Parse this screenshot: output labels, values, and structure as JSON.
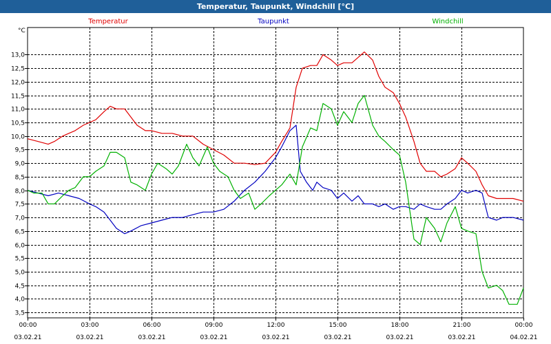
{
  "window": {
    "title": "Temperatur, Taupunkt, Windchill [°C]"
  },
  "chart_data": {
    "type": "line",
    "title": "Temperatur, Taupunkt, Windchill [°C]",
    "ylabel": "°C",
    "ylim": [
      3.3,
      14.0
    ],
    "xlim": [
      0,
      24
    ],
    "grid": true,
    "legend_position": "top",
    "y_ticks": [
      "3,5",
      "4,0",
      "4,5",
      "5,0",
      "5,5",
      "6,0",
      "6,5",
      "7,0",
      "7,5",
      "8,0",
      "8,5",
      "9,0",
      "9,5",
      "10,0",
      "10,5",
      "11,0",
      "11,5",
      "12,0",
      "12,5",
      "13,0"
    ],
    "y_tick_values": [
      3.5,
      4.0,
      4.5,
      5.0,
      5.5,
      6.0,
      6.5,
      7.0,
      7.5,
      8.0,
      8.5,
      9.0,
      9.5,
      10.0,
      10.5,
      11.0,
      11.5,
      12.0,
      12.5,
      13.0
    ],
    "x_ticks": [
      {
        "hours": 0,
        "time": "00:00",
        "date": "03.02.21"
      },
      {
        "hours": 3,
        "time": "03:00",
        "date": "03.02.21"
      },
      {
        "hours": 6,
        "time": "06:00",
        "date": "03.02.21"
      },
      {
        "hours": 9,
        "time": "09:00",
        "date": "03.02.21"
      },
      {
        "hours": 12,
        "time": "12:00",
        "date": "03.02.21"
      },
      {
        "hours": 15,
        "time": "15:00",
        "date": "03.02.21"
      },
      {
        "hours": 18,
        "time": "18:00",
        "date": "03.02.21"
      },
      {
        "hours": 21,
        "time": "21:00",
        "date": "03.02.21"
      },
      {
        "hours": 24,
        "time": "00:00",
        "date": "04.02.21"
      }
    ],
    "series": [
      {
        "name": "Temperatur",
        "color": "#e00000",
        "points": [
          [
            0,
            9.9
          ],
          [
            0.5,
            9.8
          ],
          [
            1,
            9.7
          ],
          [
            1.3,
            9.8
          ],
          [
            1.7,
            10.0
          ],
          [
            2,
            10.1
          ],
          [
            2.3,
            10.2
          ],
          [
            2.7,
            10.4
          ],
          [
            3,
            10.5
          ],
          [
            3.3,
            10.6
          ],
          [
            3.7,
            10.9
          ],
          [
            4,
            11.1
          ],
          [
            4.3,
            11.0
          ],
          [
            4.7,
            11.0
          ],
          [
            5,
            10.7
          ],
          [
            5.3,
            10.4
          ],
          [
            5.7,
            10.2
          ],
          [
            6,
            10.2
          ],
          [
            6.5,
            10.1
          ],
          [
            7,
            10.1
          ],
          [
            7.5,
            10.0
          ],
          [
            8,
            10.0
          ],
          [
            8.5,
            9.7
          ],
          [
            9,
            9.5
          ],
          [
            9.5,
            9.3
          ],
          [
            10,
            9.0
          ],
          [
            10.5,
            9.0
          ],
          [
            11,
            8.95
          ],
          [
            11.5,
            9.0
          ],
          [
            12,
            9.4
          ],
          [
            12.3,
            9.8
          ],
          [
            12.7,
            10.3
          ],
          [
            13,
            11.8
          ],
          [
            13.3,
            12.5
          ],
          [
            13.7,
            12.6
          ],
          [
            14,
            12.6
          ],
          [
            14.3,
            13.0
          ],
          [
            14.7,
            12.8
          ],
          [
            15,
            12.6
          ],
          [
            15.3,
            12.7
          ],
          [
            15.7,
            12.7
          ],
          [
            16,
            12.9
          ],
          [
            16.3,
            13.1
          ],
          [
            16.7,
            12.8
          ],
          [
            17,
            12.2
          ],
          [
            17.3,
            11.8
          ],
          [
            17.7,
            11.6
          ],
          [
            18,
            11.2
          ],
          [
            18.3,
            10.7
          ],
          [
            18.7,
            9.8
          ],
          [
            19,
            9.0
          ],
          [
            19.3,
            8.7
          ],
          [
            19.7,
            8.7
          ],
          [
            20,
            8.5
          ],
          [
            20.3,
            8.6
          ],
          [
            20.7,
            8.8
          ],
          [
            21,
            9.2
          ],
          [
            21.3,
            9.0
          ],
          [
            21.7,
            8.7
          ],
          [
            22,
            8.2
          ],
          [
            22.3,
            7.8
          ],
          [
            22.7,
            7.7
          ],
          [
            23,
            7.7
          ],
          [
            23.5,
            7.7
          ],
          [
            24,
            7.6
          ]
        ]
      },
      {
        "name": "Taupunkt",
        "color": "#0000c0",
        "points": [
          [
            0,
            8.0
          ],
          [
            0.5,
            7.9
          ],
          [
            1,
            7.8
          ],
          [
            1.5,
            7.9
          ],
          [
            2,
            7.8
          ],
          [
            2.5,
            7.7
          ],
          [
            3,
            7.5
          ],
          [
            3.3,
            7.4
          ],
          [
            3.7,
            7.2
          ],
          [
            4,
            6.9
          ],
          [
            4.3,
            6.6
          ],
          [
            4.7,
            6.4
          ],
          [
            5,
            6.5
          ],
          [
            5.5,
            6.7
          ],
          [
            6,
            6.8
          ],
          [
            6.5,
            6.9
          ],
          [
            7,
            7.0
          ],
          [
            7.5,
            7.0
          ],
          [
            8,
            7.1
          ],
          [
            8.5,
            7.2
          ],
          [
            9,
            7.2
          ],
          [
            9.5,
            7.3
          ],
          [
            10,
            7.6
          ],
          [
            10.5,
            8.0
          ],
          [
            11,
            8.3
          ],
          [
            11.5,
            8.7
          ],
          [
            12,
            9.2
          ],
          [
            12.3,
            9.6
          ],
          [
            12.7,
            10.2
          ],
          [
            13,
            10.4
          ],
          [
            13.2,
            8.7
          ],
          [
            13.5,
            8.3
          ],
          [
            13.8,
            8.0
          ],
          [
            14,
            8.3
          ],
          [
            14.3,
            8.1
          ],
          [
            14.7,
            8.0
          ],
          [
            15,
            7.7
          ],
          [
            15.3,
            7.9
          ],
          [
            15.7,
            7.6
          ],
          [
            16,
            7.8
          ],
          [
            16.3,
            7.5
          ],
          [
            16.7,
            7.5
          ],
          [
            17,
            7.4
          ],
          [
            17.3,
            7.5
          ],
          [
            17.7,
            7.3
          ],
          [
            18,
            7.4
          ],
          [
            18.3,
            7.4
          ],
          [
            18.7,
            7.3
          ],
          [
            19,
            7.5
          ],
          [
            19.3,
            7.4
          ],
          [
            19.7,
            7.3
          ],
          [
            20,
            7.3
          ],
          [
            20.3,
            7.5
          ],
          [
            20.7,
            7.7
          ],
          [
            21,
            8.0
          ],
          [
            21.3,
            7.9
          ],
          [
            21.7,
            8.0
          ],
          [
            22,
            7.9
          ],
          [
            22.3,
            7.0
          ],
          [
            22.7,
            6.9
          ],
          [
            23,
            7.0
          ],
          [
            23.5,
            7.0
          ],
          [
            24,
            6.9
          ]
        ]
      },
      {
        "name": "Windchill",
        "color": "#00b000",
        "points": [
          [
            0,
            8.0
          ],
          [
            0.3,
            7.9
          ],
          [
            0.7,
            7.9
          ],
          [
            1,
            7.5
          ],
          [
            1.3,
            7.5
          ],
          [
            1.7,
            7.8
          ],
          [
            2,
            8.0
          ],
          [
            2.3,
            8.1
          ],
          [
            2.7,
            8.5
          ],
          [
            3,
            8.5
          ],
          [
            3.3,
            8.7
          ],
          [
            3.7,
            8.9
          ],
          [
            4,
            9.4
          ],
          [
            4.3,
            9.4
          ],
          [
            4.7,
            9.2
          ],
          [
            5,
            8.3
          ],
          [
            5.3,
            8.2
          ],
          [
            5.7,
            8.0
          ],
          [
            6,
            8.6
          ],
          [
            6.3,
            9.0
          ],
          [
            6.7,
            8.8
          ],
          [
            7,
            8.6
          ],
          [
            7.3,
            8.9
          ],
          [
            7.7,
            9.7
          ],
          [
            8,
            9.2
          ],
          [
            8.3,
            8.9
          ],
          [
            8.7,
            9.6
          ],
          [
            9,
            9.0
          ],
          [
            9.3,
            8.7
          ],
          [
            9.7,
            8.5
          ],
          [
            10,
            8.0
          ],
          [
            10.3,
            7.7
          ],
          [
            10.7,
            7.9
          ],
          [
            11,
            7.3
          ],
          [
            11.3,
            7.5
          ],
          [
            11.7,
            7.8
          ],
          [
            12,
            8.0
          ],
          [
            12.3,
            8.2
          ],
          [
            12.7,
            8.6
          ],
          [
            13,
            8.2
          ],
          [
            13.3,
            9.6
          ],
          [
            13.7,
            10.3
          ],
          [
            14,
            10.2
          ],
          [
            14.3,
            11.2
          ],
          [
            14.7,
            11.0
          ],
          [
            15,
            10.4
          ],
          [
            15.3,
            10.9
          ],
          [
            15.7,
            10.5
          ],
          [
            16,
            11.2
          ],
          [
            16.3,
            11.5
          ],
          [
            16.7,
            10.4
          ],
          [
            17,
            10.0
          ],
          [
            17.3,
            9.8
          ],
          [
            17.7,
            9.5
          ],
          [
            18,
            9.3
          ],
          [
            18.3,
            8.3
          ],
          [
            18.7,
            6.2
          ],
          [
            19,
            6.0
          ],
          [
            19.3,
            7.0
          ],
          [
            19.7,
            6.6
          ],
          [
            20,
            6.1
          ],
          [
            20.3,
            6.8
          ],
          [
            20.7,
            7.4
          ],
          [
            21,
            6.6
          ],
          [
            21.3,
            6.5
          ],
          [
            21.7,
            6.4
          ],
          [
            22,
            5.0
          ],
          [
            22.3,
            4.4
          ],
          [
            22.7,
            4.5
          ],
          [
            23,
            4.3
          ],
          [
            23.3,
            3.8
          ],
          [
            23.7,
            3.8
          ],
          [
            24,
            4.4
          ]
        ]
      }
    ]
  }
}
